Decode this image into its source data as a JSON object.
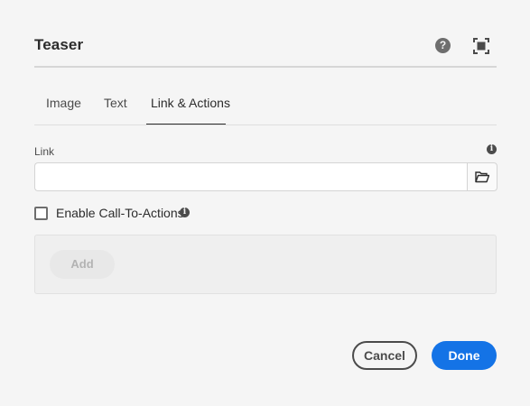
{
  "dialog": {
    "title": "Teaser",
    "help_icon": "help-icon",
    "help_glyph": "?",
    "fullscreen_icon": "fullscreen-icon"
  },
  "tabs": [
    {
      "label": "Image",
      "active": false
    },
    {
      "label": "Text",
      "active": false
    },
    {
      "label": "Link & Actions",
      "active": true
    }
  ],
  "link": {
    "label": "Link",
    "value": "",
    "placeholder": "",
    "info_icon": "info-icon",
    "info_glyph": "i",
    "browse_icon": "folder-icon"
  },
  "cta": {
    "checkbox_label": "Enable Call-To-Actions",
    "checked": false,
    "info_icon": "info-icon",
    "info_glyph": "i",
    "add_label": "Add",
    "add_disabled": true
  },
  "footer": {
    "cancel_label": "Cancel",
    "done_label": "Done"
  },
  "colors": {
    "background": "#f5f5f5",
    "accent": "#1473e6",
    "text": "#2c2c2c"
  }
}
